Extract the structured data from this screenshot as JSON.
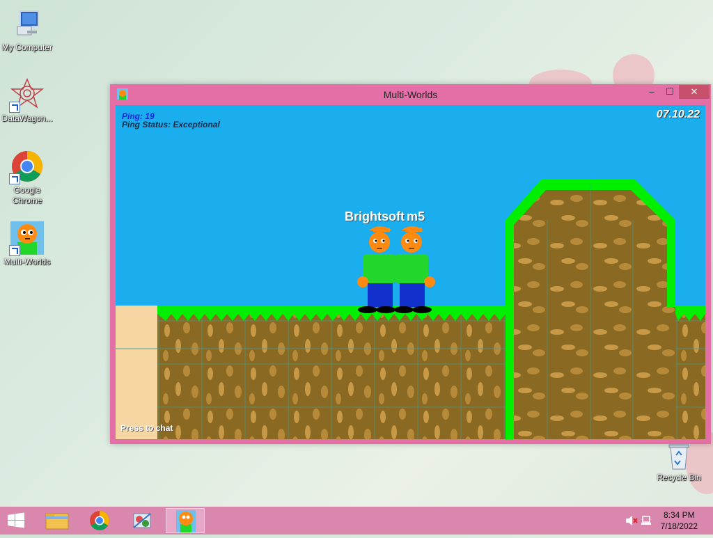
{
  "desktop": {
    "icons": [
      {
        "label": "My Computer",
        "icon": "computer-icon"
      },
      {
        "label": "DataWagon...",
        "icon": "datawagon-icon"
      },
      {
        "label": "Google Chrome",
        "icon": "chrome-icon"
      },
      {
        "label": "Multi-Worlds",
        "icon": "multiworlds-icon"
      },
      {
        "label": "Recycle Bin",
        "icon": "recycle-bin-icon"
      }
    ]
  },
  "window": {
    "title": "Multi-Worlds",
    "controls": {
      "minimize": "–",
      "maximize": "☐",
      "close": "✕"
    }
  },
  "game": {
    "ping": "Ping: 19",
    "ping_status": "Ping Status: Exceptional",
    "date": "07.10.22",
    "chat_hint": "Press  to chat",
    "player_names": [
      "Brightsoft",
      "m5"
    ],
    "colors": {
      "sky": "#1aaeef",
      "grass": "#00ee00",
      "dirt": "#8a6a22",
      "sand": "#f6d7a4"
    }
  },
  "taskbar": {
    "start_icon": "windows-start-icon",
    "pinned": [
      "file-explorer-icon",
      "chrome-icon",
      "control-panel-icon",
      "multiworlds-icon"
    ],
    "clock_time": "8:34 PM",
    "clock_date": "7/18/2022",
    "tray_icons": [
      "volume-muted-icon",
      "network-icon"
    ]
  }
}
